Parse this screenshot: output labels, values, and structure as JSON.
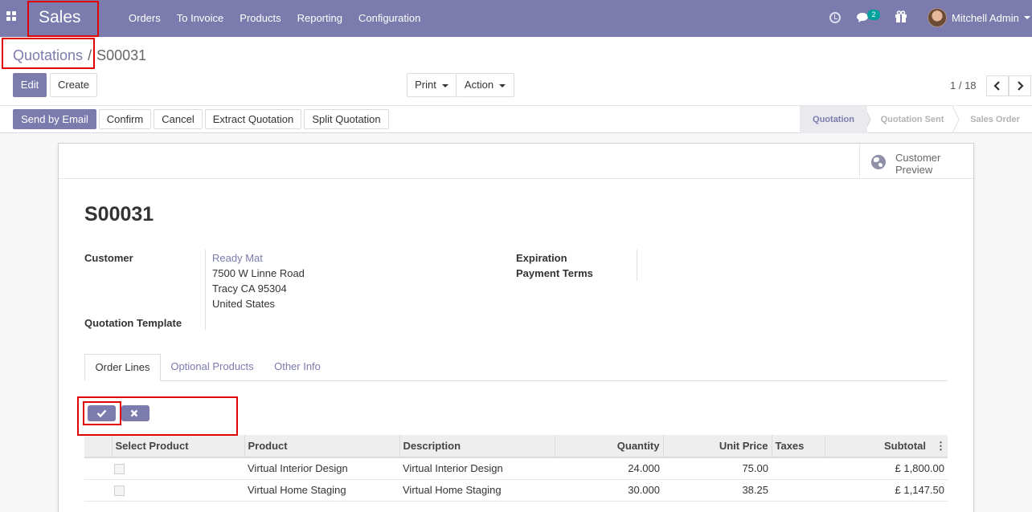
{
  "navbar": {
    "app_name": "Sales",
    "menu": [
      "Orders",
      "To Invoice",
      "Products",
      "Reporting",
      "Configuration"
    ],
    "chat_count": "2",
    "user_name": "Mitchell Admin",
    "accent_color": "#7c7bad"
  },
  "breadcrumb": {
    "parent": "Quotations",
    "separator": "/",
    "current": "S00031"
  },
  "actions": {
    "edit": "Edit",
    "create": "Create",
    "print": "Print",
    "action": "Action",
    "pager": "1 / 18"
  },
  "statusbar": {
    "buttons": [
      "Send by Email",
      "Confirm",
      "Cancel",
      "Extract Quotation",
      "Split Quotation"
    ],
    "stages": [
      "Quotation",
      "Quotation Sent",
      "Sales Order"
    ],
    "active_stage": "Quotation"
  },
  "sheet": {
    "customer_preview": "Customer Preview",
    "record_name": "S00031",
    "customer_label": "Customer",
    "customer_name": "Ready Mat",
    "address_line1": "7500 W Linne Road",
    "address_line2": "Tracy CA 95304",
    "address_line3": "United States",
    "template_label": "Quotation Template",
    "expiration_label": "Expiration",
    "payment_terms_label": "Payment Terms"
  },
  "tabs": [
    "Order Lines",
    "Optional Products",
    "Other Info"
  ],
  "table": {
    "headers": [
      "Select Product",
      "Product",
      "Description",
      "Quantity",
      "Unit Price",
      "Taxes",
      "Subtotal"
    ],
    "rows": [
      {
        "product": "Virtual Interior Design",
        "description": "Virtual Interior Design",
        "quantity": "24.000",
        "unit_price": "75.00",
        "taxes": "",
        "subtotal": "£ 1,800.00"
      },
      {
        "product": "Virtual Home Staging",
        "description": "Virtual Home Staging",
        "quantity": "30.000",
        "unit_price": "38.25",
        "taxes": "",
        "subtotal": "£ 1,147.50"
      }
    ]
  },
  "icons": [
    "apps-icon",
    "clock-icon",
    "chat-icon",
    "gift-icon",
    "globe-icon",
    "check-icon",
    "close-icon",
    "chevron-left-icon",
    "chevron-right-icon"
  ]
}
